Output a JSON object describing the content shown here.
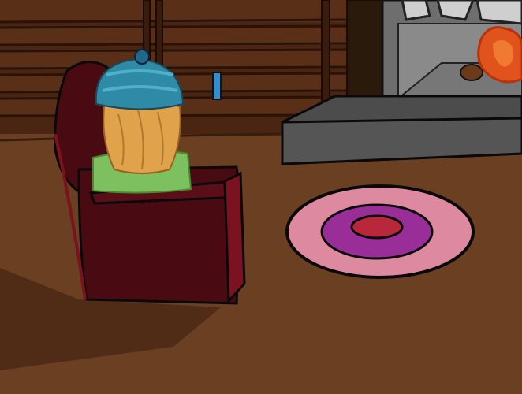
{
  "scene": {
    "description_tags": [
      "living-room",
      "armchair",
      "knit-hat-character",
      "fireplace",
      "rug",
      "bookshelf",
      "book"
    ],
    "colors": {
      "floor": "#6b3f22",
      "wall": "#4a2612",
      "shelf_board": "#5a2f17",
      "shelf_line": "#2a1208",
      "hearth": "#4c4c4c",
      "fireplace_stone": "#9a9a9a",
      "fire": "#e0531c",
      "chair": "#4a0a12",
      "chair_light": "#7a1220",
      "rug_outer": "#dd8aa0",
      "rug_mid": "#9a2e98",
      "rug_inner": "#b8283a",
      "hat": "#2f8aa8",
      "scarf": "#7cc060",
      "body": "#e0a24a",
      "book": "#2f8fd0"
    },
    "icons": {
      "armchair": "armchair-icon",
      "hat": "knit-hat-icon",
      "fire": "fire-icon",
      "book": "book-icon"
    }
  }
}
